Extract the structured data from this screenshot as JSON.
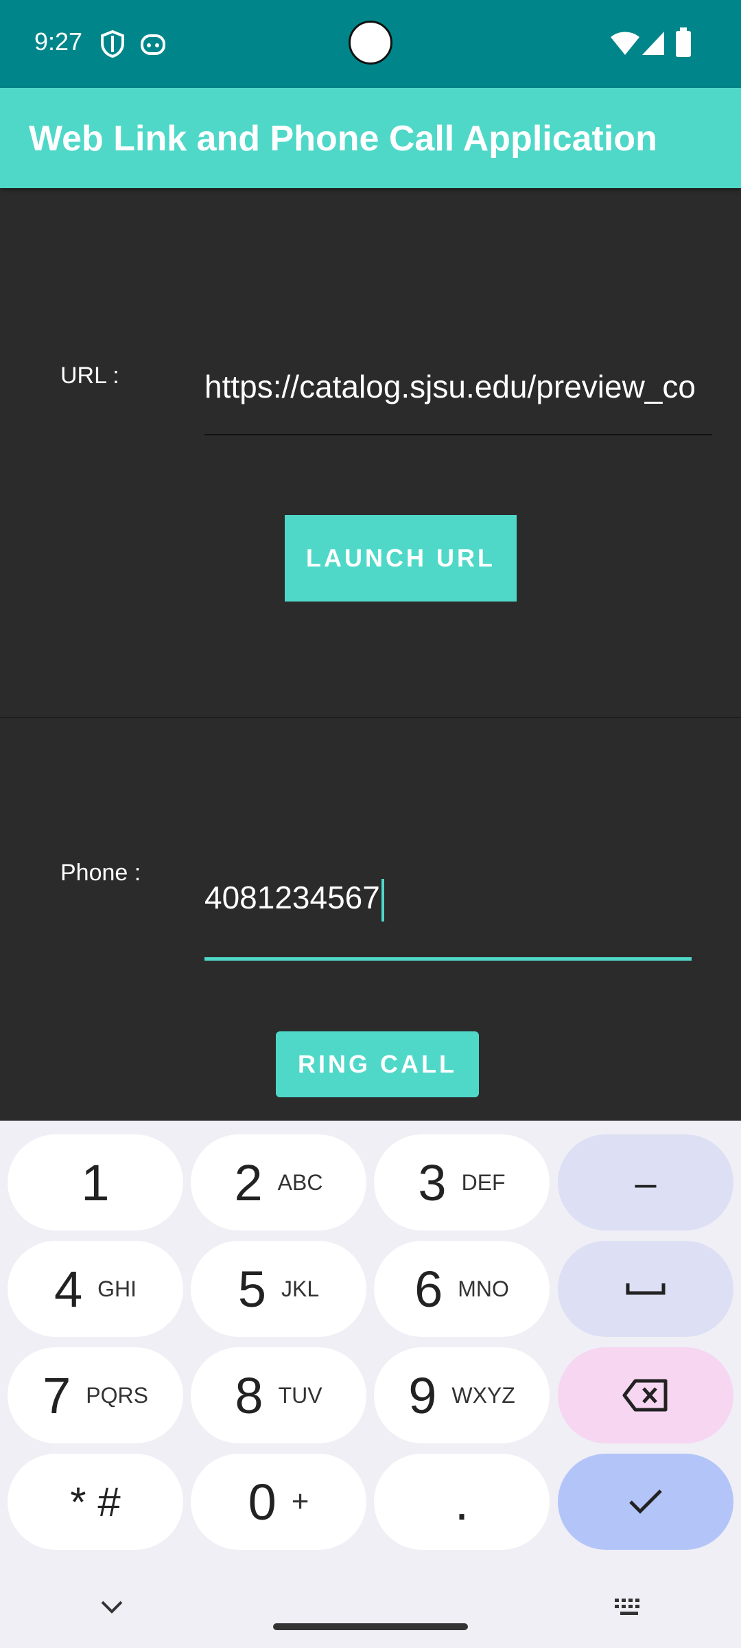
{
  "status_bar": {
    "time": "9:27"
  },
  "app_bar": {
    "title": "Web Link and Phone Call Application"
  },
  "url_section": {
    "label": "URL :",
    "value": "https://catalog.sjsu.edu/preview_co",
    "button": "LAUNCH URL"
  },
  "phone_section": {
    "label": "Phone :",
    "value": "4081234567",
    "button": "RING CALL"
  },
  "keyboard": {
    "keys": [
      {
        "num": "1",
        "sub": ""
      },
      {
        "num": "2",
        "sub": "ABC"
      },
      {
        "num": "3",
        "sub": "DEF"
      },
      {
        "num": "4",
        "sub": "GHI"
      },
      {
        "num": "5",
        "sub": "JKL"
      },
      {
        "num": "6",
        "sub": "MNO"
      },
      {
        "num": "7",
        "sub": "PQRS"
      },
      {
        "num": "8",
        "sub": "TUV"
      },
      {
        "num": "9",
        "sub": "WXYZ"
      },
      {
        "num": "* #",
        "sub": ""
      },
      {
        "num": "0",
        "sub": "+"
      },
      {
        "num": ".",
        "sub": ""
      }
    ],
    "minus_label": "–"
  },
  "colors": {
    "accent": "#4fd8c8",
    "status_bar": "#00868a",
    "background": "#2b2b2b"
  }
}
